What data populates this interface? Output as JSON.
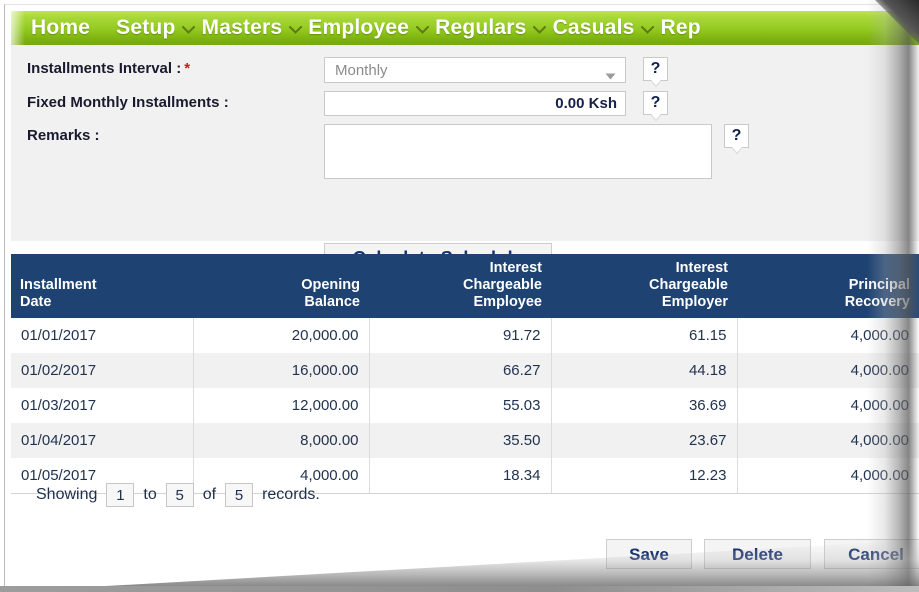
{
  "nav": {
    "items": [
      {
        "label": "Home",
        "has_caret": false
      },
      {
        "label": "Setup",
        "has_caret": true
      },
      {
        "label": "Masters",
        "has_caret": true
      },
      {
        "label": "Employee",
        "has_caret": true
      },
      {
        "label": "Regulars",
        "has_caret": true
      },
      {
        "label": "Casuals",
        "has_caret": true
      },
      {
        "label": "Rep",
        "has_caret": false
      }
    ],
    "bg_color": "#94ca22",
    "text_color": "#ffffff"
  },
  "form": {
    "installments_interval": {
      "label": "Installments Interval :",
      "required_marker": "*",
      "value": "Monthly",
      "help": "?"
    },
    "fixed_monthly_installments": {
      "label": "Fixed Monthly Installments :",
      "value": "0.00 Ksh",
      "help": "?"
    },
    "remarks": {
      "label": "Remarks :",
      "value": "",
      "help": "?"
    },
    "calculate_button": "Calculate Schedule"
  },
  "table": {
    "headers": [
      "Installment Date",
      "Opening Balance",
      "Interest Chargeable Employee",
      "Interest Chargeable Employer",
      "Principal Recovery"
    ],
    "header_lines": [
      [
        "Installment",
        "Date"
      ],
      [
        "Opening",
        "Balance"
      ],
      [
        "Interest",
        "Chargeable",
        "Employee"
      ],
      [
        "Interest",
        "Chargeable",
        "Employer"
      ],
      [
        "Principal",
        "Recovery"
      ]
    ],
    "header_bg": "#1e4272",
    "rows": [
      [
        "01/01/2017",
        "20,000.00",
        "91.72",
        "61.15",
        "4,000.00"
      ],
      [
        "01/02/2017",
        "16,000.00",
        "66.27",
        "44.18",
        "4,000.00"
      ],
      [
        "01/03/2017",
        "12,000.00",
        "55.03",
        "36.69",
        "4,000.00"
      ],
      [
        "01/04/2017",
        "8,000.00",
        "35.50",
        "23.67",
        "4,000.00"
      ],
      [
        "01/05/2017",
        "4,000.00",
        "18.34",
        "12.23",
        "4,000.00"
      ]
    ]
  },
  "pagination": {
    "showing_label": "Showing",
    "from": "1",
    "to_label": "to",
    "to": "5",
    "of_label": "of",
    "total": "5",
    "records_label": "records."
  },
  "footer": {
    "save_label": "Save",
    "delete_label": "Delete",
    "cancel_label": "Cancel"
  }
}
